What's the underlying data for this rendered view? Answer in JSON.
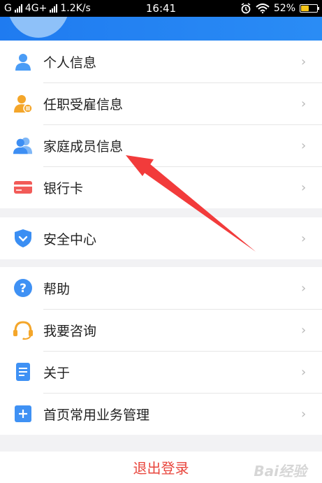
{
  "status_bar": {
    "carrier_left": "G",
    "network": "4G+",
    "speed": "1.2K/s",
    "time": "16:41",
    "battery_percent": "52%",
    "battery_level": 0.52
  },
  "menu": {
    "group1": [
      {
        "label": "个人信息",
        "icon": "person-icon"
      },
      {
        "label": "任职受雇信息",
        "icon": "employee-badge-icon"
      },
      {
        "label": "家庭成员信息",
        "icon": "family-members-icon"
      },
      {
        "label": "银行卡",
        "icon": "bank-card-icon"
      }
    ],
    "group2": [
      {
        "label": "安全中心",
        "icon": "shield-icon"
      }
    ],
    "group3": [
      {
        "label": "帮助",
        "icon": "help-icon"
      },
      {
        "label": "我要咨询",
        "icon": "headset-icon"
      },
      {
        "label": "关于",
        "icon": "document-icon"
      },
      {
        "label": "首页常用业务管理",
        "icon": "plus-square-icon"
      }
    ]
  },
  "logout_label": "退出登录",
  "watermark": "Bai经验",
  "colors": {
    "header": "#1f7bf0",
    "logout": "#e8453c",
    "annotation_arrow": "#f23b3b"
  }
}
